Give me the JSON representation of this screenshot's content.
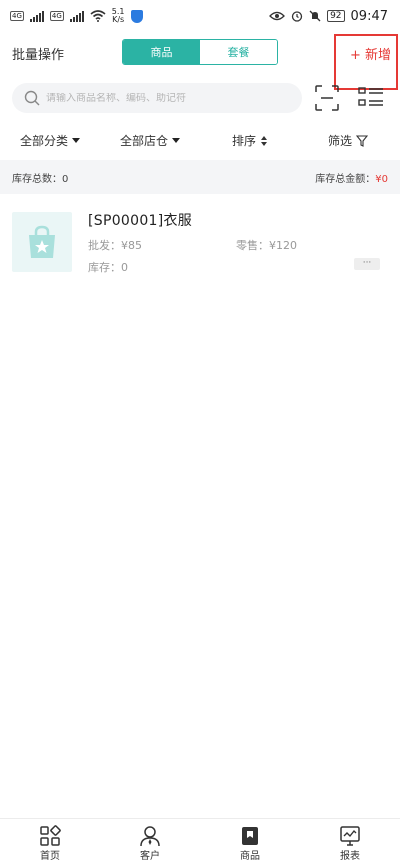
{
  "status_bar": {
    "network_tag_1": "4G",
    "network_tag_2": "4G",
    "speed_value": "5.1",
    "speed_unit": "K/s",
    "battery": "92",
    "time": "09:47"
  },
  "header": {
    "batch_label": "批量操作",
    "tabs": [
      {
        "label": "商品",
        "active": true
      },
      {
        "label": "套餐",
        "active": false
      }
    ],
    "add_label": "+ 新增"
  },
  "search": {
    "placeholder": "请输入商品名称、编码、助记符"
  },
  "filters": {
    "category": "全部分类",
    "warehouse": "全部店仓",
    "sort": "排序",
    "filter": "筛选"
  },
  "summary": {
    "total_count_label": "库存总数：",
    "total_count_value": "0",
    "total_amount_label": "库存总金额：",
    "total_amount_value": "¥0"
  },
  "products": [
    {
      "name": "[SP00001]衣服",
      "wholesale_label": "批发：",
      "wholesale_value": "¥85",
      "retail_label": "零售：",
      "retail_value": "¥120",
      "stock_label": "库存：",
      "stock_value": "0",
      "more": "···"
    }
  ],
  "tabbar": {
    "items": [
      {
        "label": "首页",
        "icon": "home-grid-icon"
      },
      {
        "label": "客户",
        "icon": "customer-icon"
      },
      {
        "label": "商品",
        "icon": "product-icon",
        "active": true
      },
      {
        "label": "报表",
        "icon": "report-icon"
      }
    ]
  },
  "colors": {
    "accent": "#2bb3a4",
    "danger": "#e53935"
  }
}
